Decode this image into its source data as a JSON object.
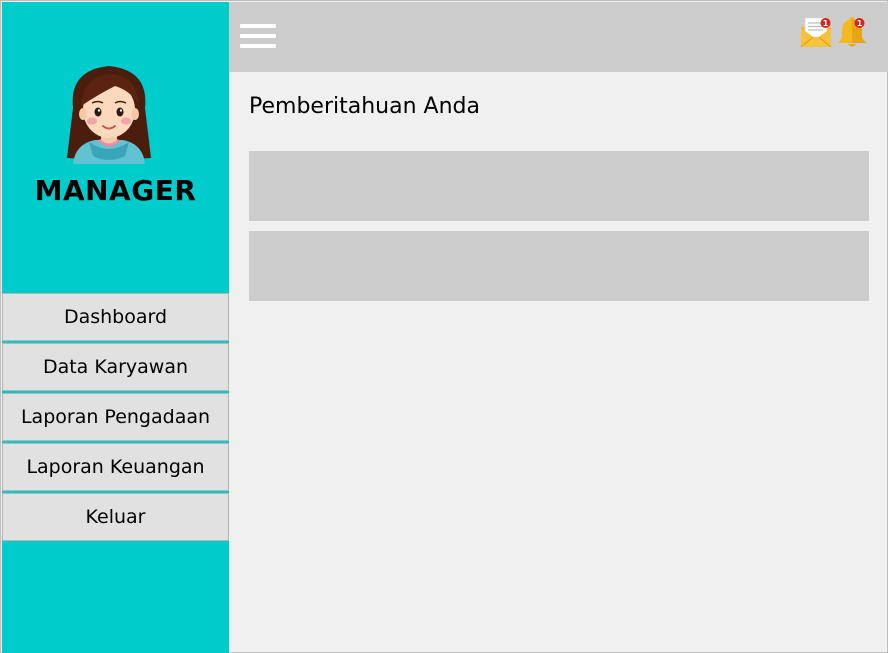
{
  "sidebar": {
    "role": "MANAGER",
    "avatar": "woman-avatar-icon",
    "menu": [
      {
        "label": "Dashboard"
      },
      {
        "label": "Data Karyawan"
      },
      {
        "label": "Laporan Pengadaan"
      },
      {
        "label": "Laporan Keuangan"
      },
      {
        "label": "Keluar"
      }
    ]
  },
  "topbar": {
    "menu_icon": "hamburger-icon",
    "mail_icon": "mail-icon",
    "mail_badge": "1",
    "bell_icon": "bell-icon",
    "bell_badge": "1"
  },
  "content": {
    "title": "Pemberitahuan Anda",
    "notifications": [
      {
        "text": ""
      },
      {
        "text": ""
      }
    ]
  },
  "colors": {
    "sidebar": "#00cccc",
    "topbar": "#cccccc",
    "background": "#f0f0f0",
    "menu_item": "#e1e1e1",
    "badge": "#d3261c",
    "bell": "#f6b81e",
    "mail": "#f7b520"
  }
}
